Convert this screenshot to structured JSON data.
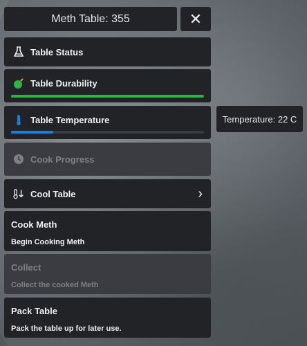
{
  "header": {
    "title": "Meth Table: 355",
    "close_glyph": "✕"
  },
  "menu": {
    "table_status": {
      "label": "Table Status",
      "icon": "flask-icon"
    },
    "table_durability": {
      "label": "Table Durability",
      "icon": "bomb-icon",
      "progress": 1.0,
      "color": "#2fb344"
    },
    "table_temperature": {
      "label": "Table Temperature",
      "icon": "thermometer-icon",
      "progress": 0.22,
      "color": "#1c7ed6"
    },
    "cook_progress": {
      "label": "Cook Progress",
      "icon": "clock-icon",
      "disabled": true
    },
    "cool_table": {
      "label": "Cool Table",
      "icon": "thermometer-down-icon",
      "chevron": "›"
    },
    "cook_meth": {
      "title": "Cook Meth",
      "description": "Begin Cooking Meth"
    },
    "collect": {
      "title": "Collect",
      "description": "Collect the cooked Meth",
      "disabled": true
    },
    "pack_table": {
      "title": "Pack Table",
      "description": "Pack the table up for later use."
    }
  },
  "tooltip": {
    "text": "Temperature: 22 C"
  }
}
